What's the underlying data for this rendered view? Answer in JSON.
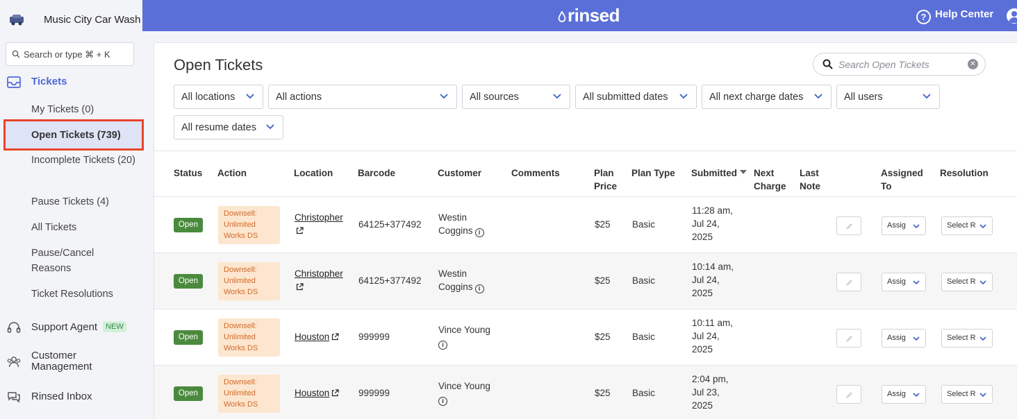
{
  "sidebar": {
    "brand": "Music City Car Wash",
    "search_placeholder": "Search or type ⌘ + K",
    "tickets_label": "Tickets",
    "ticket_items": [
      "My Tickets (0)",
      "Open Tickets (739)",
      "Incomplete Tickets (20)",
      "Pause Tickets (4)",
      "All Tickets",
      "Pause/Cancel Reasons",
      "Ticket Resolutions"
    ],
    "support_agent_label": "Support Agent",
    "new_badge": "NEW",
    "customer_mgmt_label": "Customer Management",
    "inbox_label": "Rinsed Inbox"
  },
  "header": {
    "logo": "rinsed",
    "help": "Help Center"
  },
  "main": {
    "title": "Open Tickets",
    "search_placeholder": "Search Open Tickets",
    "filters": [
      "All locations",
      "All actions",
      "All sources",
      "All submitted dates",
      "All next charge dates",
      "All users",
      "All resume dates"
    ],
    "columns": [
      "Status",
      "Action",
      "Location",
      "Barcode",
      "Customer",
      "Comments",
      "Plan Price",
      "Plan Type",
      "Submitted",
      "Next Charge",
      "Last Note",
      "Assigned To",
      "Resolution"
    ],
    "rows": [
      {
        "status": "Open",
        "action": "Downsell: Unlimited Works DS",
        "location": "Christopher",
        "barcode": "64125+377492",
        "customer": "Westin Coggins",
        "price": "$25",
        "plan": "Basic",
        "submitted": "11:28 am, Jul 24, 2025",
        "assigned": "Assig",
        "resolution": "Select R"
      },
      {
        "status": "Open",
        "action": "Downsell: Unlimited Works DS",
        "location": "Christopher",
        "barcode": "64125+377492",
        "customer": "Westin Coggins",
        "price": "$25",
        "plan": "Basic",
        "submitted": "10:14 am, Jul 24, 2025",
        "assigned": "Assig",
        "resolution": "Select R"
      },
      {
        "status": "Open",
        "action": "Downsell: Unlimited Works DS",
        "location": "Houston",
        "barcode": "999999",
        "customer": "Vince Young",
        "price": "$25",
        "plan": "Basic",
        "submitted": "10:11 am, Jul 24, 2025",
        "assigned": "Assig",
        "resolution": "Select R"
      },
      {
        "status": "Open",
        "action": "Downsell: Unlimited Works DS",
        "location": "Houston",
        "barcode": "999999",
        "customer": "Vince Young",
        "price": "$25",
        "plan": "Basic",
        "submitted": "2:04 pm, Jul 23, 2025",
        "assigned": "Assig",
        "resolution": "Select R"
      }
    ]
  },
  "colors": {
    "accent": "#5a6fd8",
    "open": "#4a8a3d",
    "action_bg": "#fde6cf",
    "action_text": "#d06a2a",
    "highlight": "#e8442b"
  }
}
